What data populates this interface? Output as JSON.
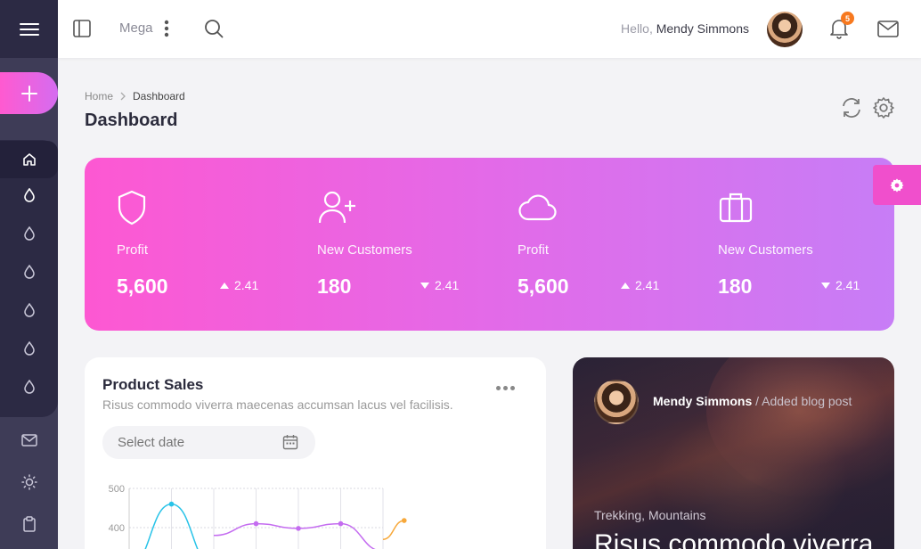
{
  "topbar": {
    "mega_label": "Mega",
    "greeting": "Hello,",
    "user_name": "Mendy Simmons",
    "notification_count": "5"
  },
  "breadcrumb": {
    "home": "Home",
    "current": "Dashboard"
  },
  "page_title": "Dashboard",
  "stats": [
    {
      "icon": "shield-icon",
      "label": "Profit",
      "value": "5,600",
      "change": "2.41",
      "trend": "up"
    },
    {
      "icon": "user-plus-icon",
      "label": "New Customers",
      "value": "180",
      "change": "2.41",
      "trend": "down"
    },
    {
      "icon": "cloud-icon",
      "label": "Profit",
      "value": "5,600",
      "change": "2.41",
      "trend": "up"
    },
    {
      "icon": "briefcase-icon",
      "label": "New Customers",
      "value": "180",
      "change": "2.41",
      "trend": "down"
    }
  ],
  "product_sales": {
    "title": "Product Sales",
    "subtitle": "Risus commodo viverra maecenas accumsan lacus vel facilisis.",
    "date_placeholder": "Select date"
  },
  "chart_data": {
    "type": "line",
    "title": "",
    "xlabel": "",
    "ylabel": "",
    "ylim": [
      300,
      500
    ],
    "y_ticks": [
      500,
      400
    ],
    "grid": true,
    "series": [
      {
        "color": "#28c3e8",
        "x": [
          0,
          1,
          2
        ],
        "values": [
          300,
          460,
          300
        ]
      },
      {
        "color": "#c46cf0",
        "x": [
          2,
          3,
          4,
          5,
          6
        ],
        "values": [
          380,
          410,
          398,
          410,
          340
        ]
      },
      {
        "color": "#f7a83a",
        "x": [
          6,
          6.5
        ],
        "values": [
          370,
          418
        ]
      }
    ]
  },
  "blog": {
    "author": "Mendy Simmons",
    "action": "/ Added blog post",
    "tags": "Trekking,  Mountains",
    "title": "Risus commodo viverra"
  },
  "colors": {
    "sidebar": "#3e3c57",
    "sidebar_dark": "#2c2a44",
    "accent_pink": "#fd58d2",
    "accent_purple": "#c77df6",
    "badge": "#f7791f"
  }
}
